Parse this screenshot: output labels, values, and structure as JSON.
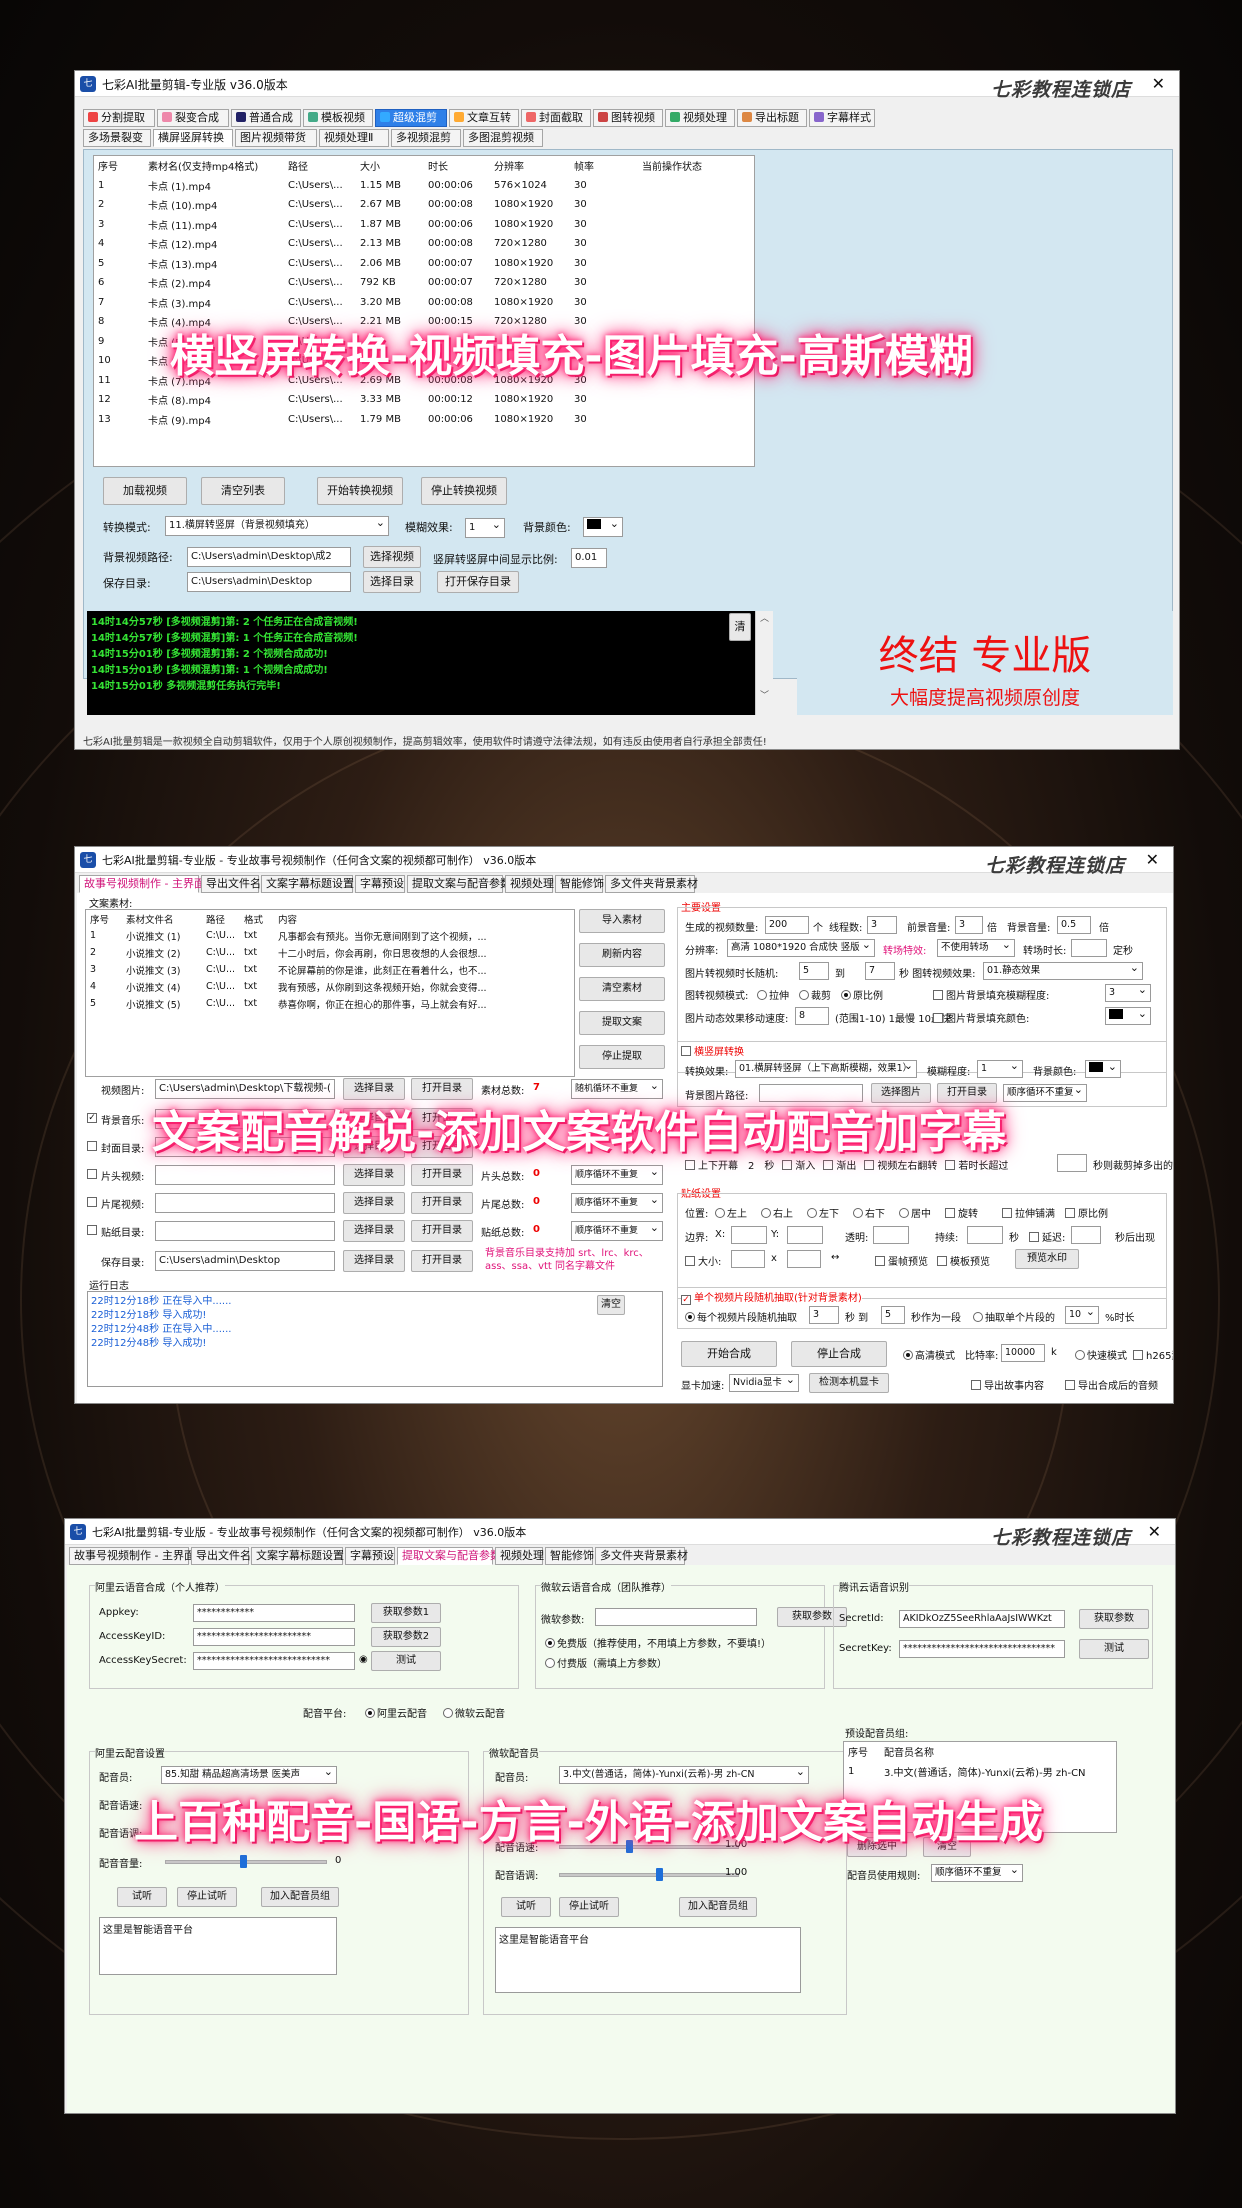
{
  "brand": "七彩教程连锁店",
  "w1": {
    "title": "七彩AI批量剪辑-专业版   v36.0版本",
    "tabs": [
      "分割提取",
      "裂变合成",
      "普通合成",
      "模板视频",
      "超级混剪",
      "文章互转",
      "封面截取",
      "图转视频",
      "视频处理",
      "导出标题",
      "字幕样式"
    ],
    "subtabs": [
      "多场景裂变",
      "横屏竖屏转换",
      "图片视频带货",
      "视频处理Ⅱ",
      "多视频混剪",
      "多图混剪视频"
    ],
    "columns": [
      "序号",
      "素材名(仅支持mp4格式)",
      "路径",
      "大小",
      "时长",
      "分辨率",
      "帧率",
      "当前操作状态"
    ],
    "rows": [
      [
        "1",
        "卡点 (1).mp4",
        "C:\\Users\\...",
        "1.15 MB",
        "00:00:06",
        "576×1024",
        "30",
        ""
      ],
      [
        "2",
        "卡点 (10).mp4",
        "C:\\Users\\...",
        "2.67 MB",
        "00:00:08",
        "1080×1920",
        "30",
        ""
      ],
      [
        "3",
        "卡点 (11).mp4",
        "C:\\Users\\...",
        "1.87 MB",
        "00:00:06",
        "1080×1920",
        "30",
        ""
      ],
      [
        "4",
        "卡点 (12).mp4",
        "C:\\Users\\...",
        "2.13 MB",
        "00:00:08",
        "720×1280",
        "30",
        ""
      ],
      [
        "5",
        "卡点 (13).mp4",
        "C:\\Users\\...",
        "2.06 MB",
        "00:00:07",
        "1080×1920",
        "30",
        ""
      ],
      [
        "6",
        "卡点 (2).mp4",
        "C:\\Users\\...",
        "792 KB",
        "00:00:07",
        "720×1280",
        "30",
        ""
      ],
      [
        "7",
        "卡点 (3).mp4",
        "C:\\Users\\...",
        "3.20 MB",
        "00:00:08",
        "1080×1920",
        "30",
        ""
      ],
      [
        "8",
        "卡点 (4).mp4",
        "C:\\Users\\...",
        "2.21 MB",
        "00:00:15",
        "720×1280",
        "30",
        ""
      ],
      [
        "9",
        "卡点 (5).mp4",
        "C:\\Users\\...",
        "",
        "",
        "",
        "",
        ""
      ],
      [
        "10",
        "卡点 (6).mp4",
        "C:\\Users\\...",
        "",
        "",
        "",
        "",
        ""
      ],
      [
        "11",
        "卡点 (7).mp4",
        "C:\\Users\\...",
        "2.69 MB",
        "00:00:08",
        "1080×1920",
        "30",
        ""
      ],
      [
        "12",
        "卡点 (8).mp4",
        "C:\\Users\\...",
        "3.33 MB",
        "00:00:12",
        "1080×1920",
        "30",
        ""
      ],
      [
        "13",
        "卡点 (9).mp4",
        "C:\\Users\\...",
        "1.79 MB",
        "00:00:06",
        "1080×1920",
        "30",
        ""
      ]
    ],
    "btn_load": "加载视频",
    "btn_clear": "清空列表",
    "btn_start": "开始转换视频",
    "btn_stop": "停止转换视频",
    "mode_label": "转换模式:",
    "mode_value": "11.横屏转竖屏（背景视频填充）",
    "blur_label": "模糊效果:",
    "blur_value": "1",
    "bgcolor_label": "背景颜色:",
    "bgpath_label": "背景视频路径:",
    "bgpath_value": "C:\\Users\\admin\\Desktop\\成2",
    "btn_select_video": "选择视频",
    "ratio_label": "竖屏转竖屏中间显示比例:",
    "ratio_value": "0.01",
    "save_label": "保存目录:",
    "save_value": "C:\\Users\\admin\\Desktop",
    "btn_select_dir": "选择目录",
    "btn_open_dir": "打开保存目录",
    "log": [
      "14时14分57秒 [多视频混剪]第: 2 个任务正在合成音视频!",
      "14时14分57秒 [多视频混剪]第: 1 个任务正在合成音视频!",
      "14时15分01秒 [多视频混剪]第: 2 个视频合成成功!",
      "14时15分01秒 [多视频混剪]第: 1 个视频合成成功!",
      "14时15分01秒 多视频混剪任务执行完毕!"
    ],
    "log_clear": "清",
    "promo_title": "终结 专业版",
    "promo_sub": "大幅度提高视频原创度",
    "status": "七彩AI批量剪辑是一款视频全自动剪辑软件，仅用于个人原创视频制作，提高剪辑效率，使用软件时请遵守法律法规，如有违反由使用者自行承担全部责任!",
    "banner": "横竖屏转换-视频填充-图片填充-高斯模糊"
  },
  "w2": {
    "title": "七彩AI批量剪辑-专业版 - 专业故事号视频制作（任何含文案的视频都可制作）   v36.0版本",
    "tabs": [
      "故事号视频制作 - 主界面",
      "导出文件名",
      "文案字幕标题设置",
      "字幕预设",
      "提取文案与配音参数",
      "视频处理",
      "智能修饰",
      "多文件夹背景素材"
    ],
    "text_material": "文案素材:",
    "columns": [
      "序号",
      "素材文件名",
      "路径",
      "格式",
      "内容"
    ],
    "rows": [
      [
        "1",
        "小说推文 (1)",
        "C:\\U...",
        "txt",
        "凡事都会有预兆。当你无意间刚到了这个视频，..."
      ],
      [
        "2",
        "小说推文 (2)",
        "C:\\U...",
        "txt",
        "十二小时后，你会再刷，你日思夜想的人会很想..."
      ],
      [
        "3",
        "小说推文 (3)",
        "C:\\U...",
        "txt",
        "不论屏幕前的你是谁，此刻正在看着什么，也不..."
      ],
      [
        "4",
        "小说推文 (4)",
        "C:\\U...",
        "txt",
        "我有预感，从你刷到这条视频开始，你就会变得..."
      ],
      [
        "5",
        "小说推文 (5)",
        "C:\\U...",
        "txt",
        "恭喜你啊，你正在担心的那件事，马上就会有好..."
      ]
    ],
    "side_btns": [
      "导入素材",
      "刷新内容",
      "清空素材",
      "提取文案",
      "停止提取"
    ],
    "row_labels": [
      "视频图片:",
      "背景音乐:",
      "封面目录:",
      "片头视频:",
      "片尾视频:",
      "贴纸目录:",
      "保存目录:"
    ],
    "video_path": "C:\\Users\\admin\\Desktop\\下载视频-(",
    "save_path": "C:\\Users\\admin\\Desktop",
    "btn_select_dir": "选择目录",
    "btn_open_dir": "打开目录",
    "material_total_label": "素材总数:",
    "material_total": "7",
    "intro_total_label": "片头总数:",
    "intro_total": "0",
    "outro_total_label": "片尾总数:",
    "outro_total": "0",
    "sticker_total_label": "贴纸总数:",
    "sticker_total": "0",
    "loop_random": "随机循环不重复",
    "loop_seq": "顺序循环不重复",
    "bgm_note": "背景音乐目录支持加 srt、lrc、krc、ass、ssa、vtt 同名字幕文件",
    "log_title": "运行日志",
    "log": [
      "22时12分18秒 正在导入中......",
      "22时12分18秒 导入成功!",
      "22时12分48秒 正在导入中......",
      "22时12分48秒 导入成功!"
    ],
    "log_clear": "清空",
    "main_title": "主要设置",
    "gen_count_label": "生成的视频数量:",
    "gen_count": "200",
    "unit_ge": "个",
    "threads_label": "线程数:",
    "threads": "3",
    "fg_vol_label": "前景音量:",
    "fg_vol": "3",
    "unit_bei": "倍",
    "bg_vol_label": "背景音量:",
    "bg_vol": "0.5",
    "res_label": "分辨率:",
    "res": "高清 1080*1920 合成快 竖版",
    "trans_label": "转场特效:",
    "trans": "不使用转场",
    "trans_len_label": "转场时长:",
    "fixed": "定秒",
    "img_dur_label": "图片转视频时长随机:",
    "img_dur_from": "5",
    "to": "到",
    "img_dur_to": "7",
    "img_effect_label": "秒 图转视频效果:",
    "img_effect": "01.静态效果",
    "img_mode_label": "图转视频模式:",
    "opt_stretch": "拉伸",
    "opt_crop": "裁剪",
    "opt_orig": "原比例",
    "img_fill_blur": "图片背景填充模糊程度:",
    "img_fill_blur_val": "3",
    "img_speed_label": "图片动态效果移动速度:",
    "img_speed": "8",
    "img_speed_hint": "(范围1-10) 1最慢 10最快",
    "img_fill_color": "图片背景填充颜色:",
    "hv_title": "横竖屏转换",
    "conv_label": "转换效果:",
    "conv": "01.横屏转竖屏（上下高斯模糊，效果1）",
    "blur_label": "模糊程度:",
    "blur": "1",
    "bgcolor_label": "背景颜色:",
    "bgimg_label": "背景图片路径:",
    "btn_select_img": "选择图片",
    "btn_open_dir2": "打开目录",
    "loop_seq2": "顺序循环不重复",
    "scroll_up": "上下开幕",
    "scroll_up_sec": "2",
    "fade_in": "渐入",
    "fade_out": "渐出",
    "lr_flip": "视频左右翻转",
    "exceed": "若时长超过",
    "crop_note": "秒则裁剪掉多出的",
    "sticker_title": "贴纸设置",
    "pos_label": "位置:",
    "positions": [
      "左上",
      "右上",
      "左下",
      "右下",
      "居中"
    ],
    "rotate": "旋转",
    "stretch_full": "拉伸铺满",
    "orig_ratio": "原比例",
    "margin_label": "边界:",
    "x": "X:",
    "y": "Y:",
    "opacity": "透明:",
    "duration": "持续:",
    "sec": "秒",
    "delay": "延迟:",
    "after_sec": "秒后出现",
    "size": "大小:",
    "mul": "x",
    "arrows": "↔",
    "gif_preview": "蛋帧预览",
    "tpl_preview": "模板预览",
    "btn_preview": "预览水印",
    "single_title": "单个视频片段随机抽取(针对背景素材)",
    "single_opt": "每个视频片段随机抽取",
    "single_from": "3",
    "single_to_sec": "秒 到",
    "single_to": "5",
    "single_seg": "秒作为一段",
    "single_extract": "抽取单个片段的",
    "single_pct": "10",
    "pct": "%时长",
    "btn_start": "开始合成",
    "btn_stop": "停止合成",
    "hq_mode": "高清模式",
    "bitrate_label": "比特率:",
    "bitrate": "10000",
    "k": "k",
    "fast_mode": "快速模式",
    "h265": "h265素材",
    "gpu_label": "显卡加速:",
    "gpu": "Nvidia显卡",
    "btn_detect_gpu": "检测本机显卡",
    "export_story": "导出故事内容",
    "export_audio": "导出合成后的音频",
    "banner": "文案配音解说-添加文案软件自动配音加字幕"
  },
  "w3": {
    "title": "七彩AI批量剪辑-专业版 - 专业故事号视频制作（任何含文案的视频都可制作）   v36.0版本",
    "tabs": [
      "故事号视频制作 - 主界面",
      "导出文件名",
      "文案字幕标题设置",
      "字幕预设",
      "提取文案与配音参数",
      "视频处理",
      "智能修饰",
      "多文件夹背景素材"
    ],
    "ali_title": "阿里云语音合成（个人推荐）",
    "appkey_label": "Appkey:",
    "appkey": "************",
    "akid_label": "AccessKeyID:",
    "akid": "************************",
    "aks_label": "AccessKeySecret:",
    "aks": "****************************",
    "btn_param1": "获取参数1",
    "btn_param2": "获取参数2",
    "btn_test": "测试",
    "wr_title": "微软云语音合成（团队推荐）",
    "wr_param_label": "微软参数:",
    "btn_get_param": "获取参数",
    "free_opt": "免费版（推荐使用，不用填上方参数，不要填!）",
    "paid_opt": "付费版（需填上方参数）",
    "tx_title": "腾讯云语音识别",
    "secretid_label": "SecretId:",
    "secretid": "AKIDkOzZ5SeeRhlaAaJsIWWKzt",
    "secretkey_label": "SecretKey:",
    "secretkey": "********************************",
    "platform_label": "配音平台:",
    "platform_ali": "阿里云配音",
    "platform_ms": "微软云配音",
    "ali_voice_title": "阿里云配音设置",
    "voice_label": "配音员:",
    "ali_voice": "85.知甜 精品超高清场景 医美声",
    "speed_label": "配音语速:",
    "pitch_label": "配音语调:",
    "volume_label": "配音音量:",
    "volume_val": "0",
    "btn_try": "试听",
    "btn_stop_try": "停止试听",
    "btn_add_group": "加入配音员组",
    "sample_text": "这里是智能语音平台",
    "ms_voice_title": "微软配音员",
    "ms_voice": "3.中文(普通话，简体)-Yunxi(云希)-男 zh-CN",
    "ms_speed": "1.00",
    "ms_pitch": "1.00",
    "preset_title": "预设配音员组:",
    "preset_cols": [
      "序号",
      "配音员名称"
    ],
    "preset_rows": [
      [
        "1",
        "3.中文(普通话，简体)-Yunxi(云希)-男 zh-CN"
      ]
    ],
    "btn_delete": "删除选中",
    "btn_clear": "清空",
    "rule_label": "配音员使用规则:",
    "rule": "顺序循环不重复",
    "banner": "上百种配音-国语-方言-外语-添加文案自动生成"
  }
}
